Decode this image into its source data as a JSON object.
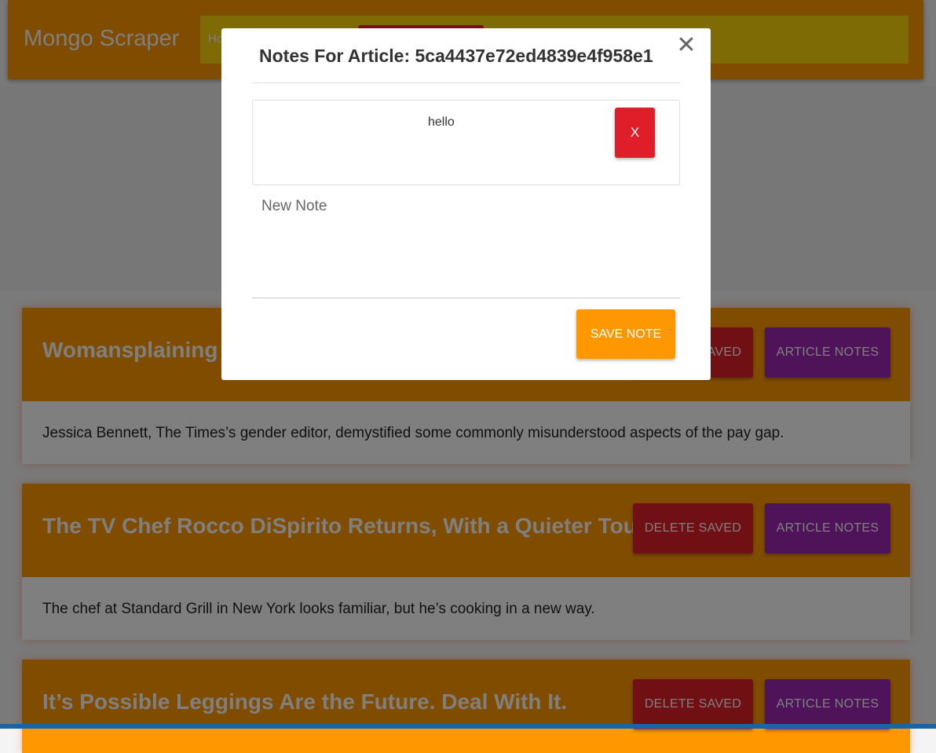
{
  "navbar": {
    "brand": "Mongo Scraper",
    "home_link": "Ho",
    "colors": {
      "bar": "#ff9800",
      "menu": "#ffd60a",
      "button": "#e8202a"
    }
  },
  "articles": [
    {
      "title": "Womansplaining t",
      "summary": "Jessica Bennett, The Times’s gender editor, demystified some commonly misunderstood aspects of the pay gap.",
      "delete_label": "DELETE SAVED",
      "notes_label": "ARTICLE NOTES"
    },
    {
      "title": "The TV Chef Rocco DiSpirito Returns, With a Quieter Touch",
      "summary": "The chef at Standard Grill in New York looks familiar, but he’s cooking in a new way.",
      "delete_label": "DELETE SAVED",
      "notes_label": "ARTICLE NOTES"
    },
    {
      "title": "It’s Possible Leggings Are the Future. Deal With It.",
      "summary": "",
      "delete_label": "DELETE SAVED",
      "notes_label": "ARTICLE NOTES"
    }
  ],
  "modal": {
    "title": "Notes For Article: 5ca4437e72ed4839e4f958e1",
    "close_icon": "close-icon",
    "notes": [
      {
        "text": "hello",
        "delete_label": "X"
      }
    ],
    "new_note_placeholder": "New Note",
    "new_note_value": "",
    "save_label": "SAVE NOTE"
  }
}
